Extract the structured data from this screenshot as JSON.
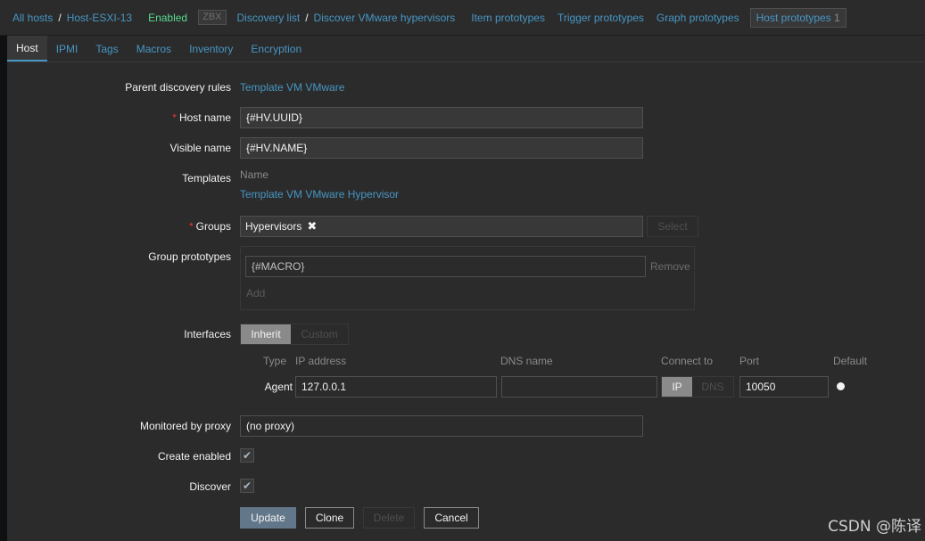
{
  "breadcrumbs": {
    "all_hosts": "All hosts",
    "sep": "/",
    "host": "Host-ESXI-13",
    "status": "Enabled",
    "zbx_badge": "ZBX",
    "discovery_list": "Discovery list",
    "rule": "Discover VMware hypervisors",
    "item_prototypes": "Item prototypes",
    "trigger_prototypes": "Trigger prototypes",
    "graph_prototypes": "Graph prototypes",
    "host_prototypes": "Host prototypes",
    "host_prototypes_count": "1"
  },
  "tabs": [
    "Host",
    "IPMI",
    "Tags",
    "Macros",
    "Inventory",
    "Encryption"
  ],
  "form": {
    "parent_rules_label": "Parent discovery rules",
    "parent_rules_value": "Template VM VMware",
    "required_mark": "*",
    "host_name_label": "Host name",
    "host_name_value": "{#HV.UUID}",
    "visible_name_label": "Visible name",
    "visible_name_value": "{#HV.NAME}",
    "templates_label": "Templates",
    "templates_col": "Name",
    "templates_value": "Template VM VMware Hypervisor",
    "groups_label": "Groups",
    "groups_chip": "Hypervisors",
    "groups_chip_remove": "✖",
    "select_button": "Select",
    "group_prototypes_label": "Group prototypes",
    "group_prototype_value": "{#MACRO}",
    "remove_link": "Remove",
    "add_link": "Add",
    "interfaces_label": "Interfaces",
    "inherit_option": "Inherit",
    "custom_option": "Custom",
    "iface_headers": {
      "type": "Type",
      "ip": "IP address",
      "dns": "DNS name",
      "connect": "Connect to",
      "port": "Port",
      "default": "Default"
    },
    "iface_row": {
      "type": "Agent",
      "ip": "127.0.0.1",
      "dns": "",
      "connect_ip": "IP",
      "connect_dns": "DNS",
      "port": "10050"
    },
    "proxy_label": "Monitored by proxy",
    "proxy_value": "(no proxy)",
    "create_enabled_label": "Create enabled",
    "discover_label": "Discover",
    "check_mark": "✔"
  },
  "buttons": {
    "update": "Update",
    "clone": "Clone",
    "delete": "Delete",
    "cancel": "Cancel"
  },
  "watermark": "CSDN @陈译"
}
